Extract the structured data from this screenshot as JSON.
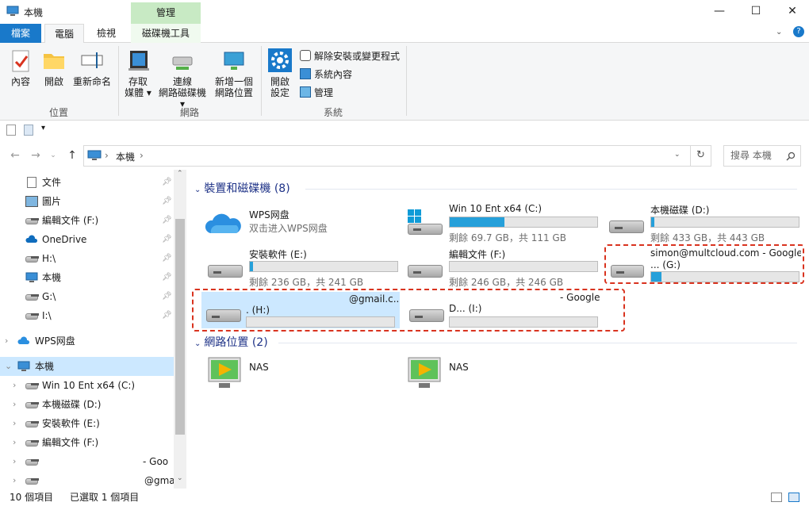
{
  "window": {
    "title": "本機",
    "context_tab_header": "管理",
    "buttons": {
      "minimize": "—",
      "maximize": "☐",
      "close": "✕"
    }
  },
  "tabs": {
    "file": "檔案",
    "computer": "電腦",
    "view": "檢視",
    "drive_tools": "磁碟機工具"
  },
  "ribbon": {
    "location": {
      "label": "位置",
      "properties": "內容",
      "open": "開啟",
      "rename": "重新命名"
    },
    "network": {
      "label": "網路",
      "access_media_1": "存取",
      "access_media_2": "媒體",
      "map_drive_1": "連線",
      "map_drive_2": "網路磁碟機",
      "add_location_1": "新增一個",
      "add_location_2": "網路位置"
    },
    "system": {
      "label": "系統",
      "open_settings_1": "開啟",
      "open_settings_2": "設定",
      "uninstall": "解除安裝或變更程式",
      "system_properties": "系統內容",
      "manage": "管理"
    }
  },
  "nav": {
    "back": "←",
    "forward": "→",
    "up": "↑",
    "address_path": "本機",
    "address_sep": "›",
    "search_placeholder": "搜尋 本機",
    "refresh": "↻"
  },
  "sidebar": {
    "quick": [
      {
        "label": "文件"
      },
      {
        "label": "圖片"
      },
      {
        "label": "編輯文件 (F:)"
      },
      {
        "label": "OneDrive"
      },
      {
        "label": "H:\\"
      },
      {
        "label": "本機"
      },
      {
        "label": "G:\\"
      },
      {
        "label": "I:\\"
      }
    ],
    "wps": "WPS网盘",
    "this_pc": "本機",
    "drives": [
      {
        "label": "Win 10 Ent x64 (C:)"
      },
      {
        "label": "本機磁碟 (D:)"
      },
      {
        "label": "安裝軟件 (E:)"
      },
      {
        "label": "編輯文件 (F:)"
      },
      {
        "label": "- Goo"
      },
      {
        "label": "@gma"
      }
    ]
  },
  "content": {
    "devices_header": "裝置和磁碟機 (8)",
    "network_header": "網路位置 (2)",
    "devices": [
      {
        "name": "WPS网盘",
        "sub": "双击进入WPS网盘"
      },
      {
        "name": "Win 10 Ent x64 (C:)",
        "sub": "剩餘 69.7 GB，共 111 GB",
        "fill": 0.37
      },
      {
        "name": "本機磁碟 (D:)",
        "sub": "剩餘 433 GB，共 443 GB",
        "fill": 0.02
      },
      {
        "name": "安裝軟件 (E:)",
        "sub": "剩餘 236 GB，共 241 GB",
        "fill": 0.02
      },
      {
        "name": "編輯文件 (F:)",
        "sub": "剩餘 246 GB，共 246 GB",
        "fill": 0.0
      },
      {
        "name": "simon@multcloud.com - Google",
        "name2": "... (G:)",
        "fill": 0.07
      },
      {
        "name": "@gmail.c..",
        "name2": ". (H:)",
        "fill": 0.0
      },
      {
        "name": "- Google",
        "name2": "D... (I:)",
        "fill": 0.0
      }
    ],
    "network": [
      {
        "name": "NAS"
      },
      {
        "name": "NAS"
      }
    ]
  },
  "status": {
    "count": "10 個項目",
    "selected": "已選取 1 個項目"
  },
  "colors": {
    "accent": "#1979ca",
    "context_tab": "#c8eac4",
    "selection": "#cce8ff",
    "bar_fill": "#26a0da",
    "highlight": "#d9331f"
  }
}
